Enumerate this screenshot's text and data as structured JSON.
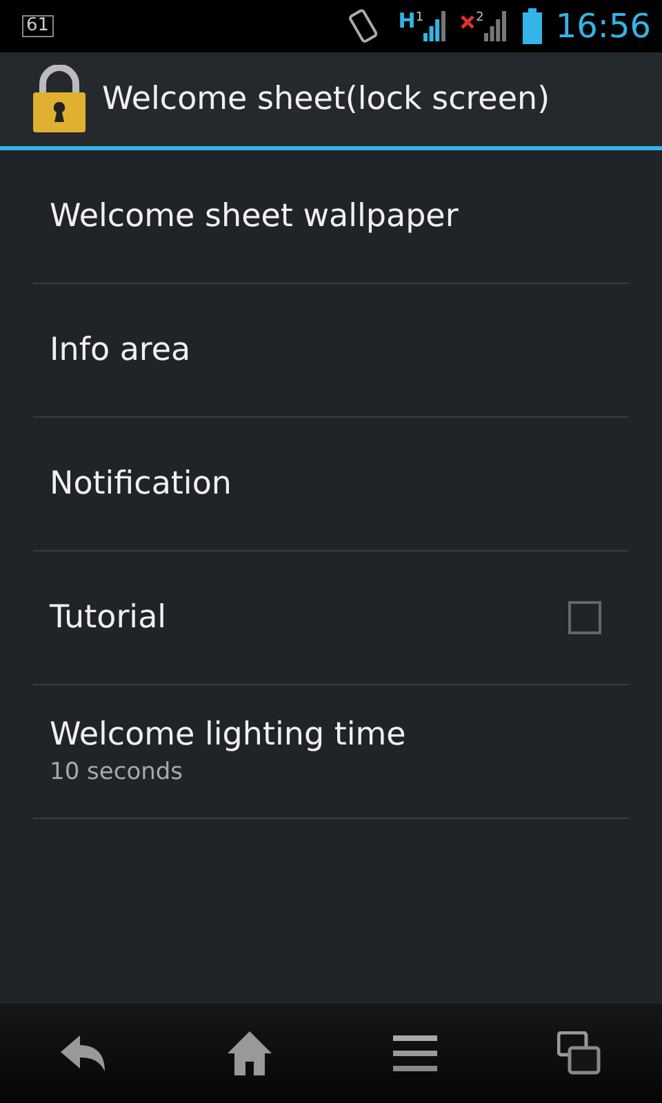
{
  "status_bar": {
    "notification_count": "61",
    "network_type": "H",
    "sim_1": "1",
    "sim_2": "2",
    "time": "16:56"
  },
  "action_bar": {
    "title": "Welcome sheet(lock screen)"
  },
  "settings": [
    {
      "kind": "plain",
      "title": "Welcome sheet wallpaper"
    },
    {
      "kind": "plain",
      "title": "Info area"
    },
    {
      "kind": "plain",
      "title": "Notification"
    },
    {
      "kind": "checkbox",
      "title": "Tutorial",
      "checked": false
    },
    {
      "kind": "summary",
      "title": "Welcome lighting time",
      "summary": "10 seconds"
    }
  ]
}
